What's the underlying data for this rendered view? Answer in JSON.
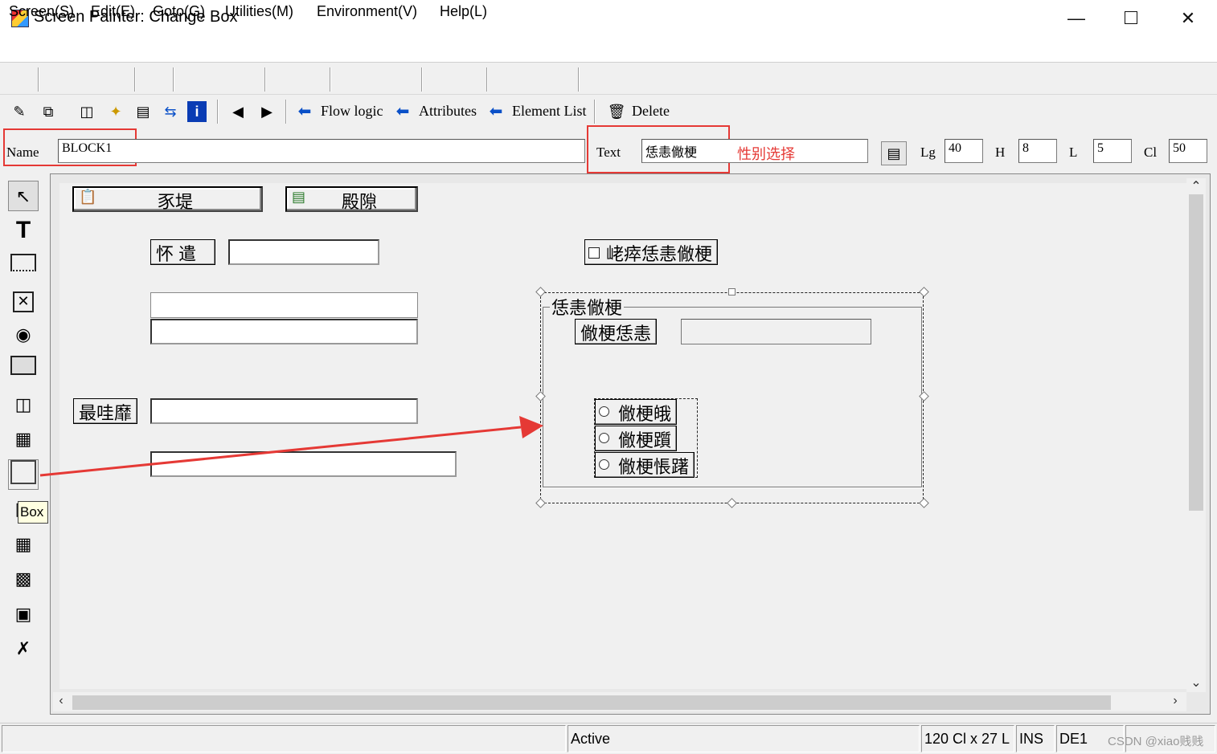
{
  "window": {
    "title": "Screen Painter:  Change Box"
  },
  "menu": [
    {
      "label": "Screen(S)"
    },
    {
      "label": "Edit(E)"
    },
    {
      "label": "Goto(G)"
    },
    {
      "label": "Utilities(M)"
    },
    {
      "label": "Environment(V)"
    },
    {
      "label": "Help(L)"
    }
  ],
  "toolbar": {
    "flow_logic": "Flow logic",
    "attributes": "Attributes",
    "element_list": "Element List",
    "delete": "Delete"
  },
  "attr_row": {
    "name_label": "Name",
    "name_value": "BLOCK1",
    "text_label": "Text",
    "text_value": "恁恚僘梗",
    "annotation": "性别选择",
    "lg_label": "Lg",
    "lg_value": "40",
    "h_label": "H",
    "h_value": "8",
    "l_label": "L",
    "l_value": "5",
    "cl_label": "Cl",
    "cl_value": "50"
  },
  "palette": {
    "tooltip": "Box"
  },
  "screen": {
    "button1": "豕堤",
    "button2": "殿隙",
    "label_name": "怀  遣",
    "checkbox_label": "峔瘁恁恚僘梗",
    "label_address": "最哇靡",
    "box_title": "恁恚僘梗",
    "box_inner_label": "僘梗恁恚",
    "radio1": "僘梗皒",
    "radio2": "僘梗躓",
    "radio3": "僘梗悵躇"
  },
  "status": {
    "mode": "Active",
    "position": "120 Cl x 27 L",
    "ins": "INS",
    "system": "DE1",
    "watermark": "CSDN @xiao贱贱"
  },
  "colors": {
    "highlight": "#e53935",
    "arrow": "#e53935",
    "toolbar_arrow": "#0a50c8"
  }
}
